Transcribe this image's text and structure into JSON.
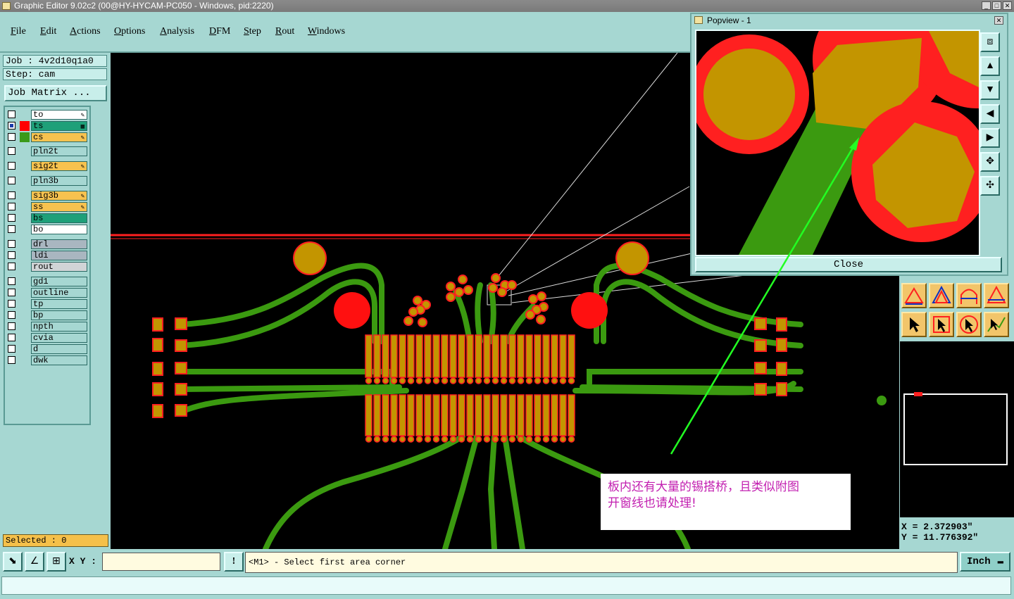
{
  "window": {
    "title": "Graphic Editor 9.02c2 (00@HY-HYCAM-PC050 - Windows, pid:2220)"
  },
  "menu": [
    "File",
    "Edit",
    "Actions",
    "Options",
    "Analysis",
    "DFM",
    "Step",
    "Rout",
    "Windows"
  ],
  "job": {
    "job_line": "Job : 4v2d10q1a0",
    "step_line": "Step: cam",
    "matrix_button": "Job Matrix ..."
  },
  "layers": [
    {
      "name": "to",
      "color": "#ffffff",
      "checked": false,
      "swatch": "",
      "mark": "✎"
    },
    {
      "name": "ts",
      "color": "#1ea079",
      "checked": true,
      "swatch": "#ff0000",
      "mark": "▦"
    },
    {
      "name": "cs",
      "color": "#f7c24f",
      "checked": false,
      "swatch": "#3a9a1a",
      "mark": "✎"
    },
    {
      "name": "pln2t",
      "color": "#a6d7d2",
      "checked": false,
      "swatch": "",
      "mark": ""
    },
    {
      "name": "sig2t",
      "color": "#f7c24f",
      "checked": false,
      "swatch": "",
      "mark": "✎"
    },
    {
      "name": "pln3b",
      "color": "#a6d7d2",
      "checked": false,
      "swatch": "",
      "mark": ""
    },
    {
      "name": "sig3b",
      "color": "#f7c24f",
      "checked": false,
      "swatch": "",
      "mark": "✎"
    },
    {
      "name": "ss",
      "color": "#f7c24f",
      "checked": false,
      "swatch": "",
      "mark": "✎"
    },
    {
      "name": "bs",
      "color": "#1ea079",
      "checked": false,
      "swatch": "",
      "mark": ""
    },
    {
      "name": "bo",
      "color": "#ffffff",
      "checked": false,
      "swatch": "",
      "mark": ""
    },
    {
      "name": "drl",
      "color": "#a9b6c0",
      "checked": false,
      "swatch": "",
      "mark": ""
    },
    {
      "name": "ldi",
      "color": "#a9b6c0",
      "checked": false,
      "swatch": "",
      "mark": ""
    },
    {
      "name": "rout",
      "color": "#d0d4d6",
      "checked": false,
      "swatch": "",
      "mark": ""
    },
    {
      "name": "gd1",
      "color": "#a6d7d2",
      "checked": false,
      "swatch": "",
      "mark": ""
    },
    {
      "name": "outline",
      "color": "#a6d7d2",
      "checked": false,
      "swatch": "",
      "mark": ""
    },
    {
      "name": "tp",
      "color": "#a6d7d2",
      "checked": false,
      "swatch": "",
      "mark": ""
    },
    {
      "name": "bp",
      "color": "#a6d7d2",
      "checked": false,
      "swatch": "",
      "mark": ""
    },
    {
      "name": "npth",
      "color": "#a6d7d2",
      "checked": false,
      "swatch": "",
      "mark": ""
    },
    {
      "name": "cvia",
      "color": "#a6d7d2",
      "checked": false,
      "swatch": "",
      "mark": ""
    },
    {
      "name": "d",
      "color": "#a6d7d2",
      "checked": false,
      "swatch": "",
      "mark": ""
    },
    {
      "name": "dwk",
      "color": "#a6d7d2",
      "checked": false,
      "swatch": "",
      "mark": ""
    }
  ],
  "selected": "Selected : 0",
  "popview": {
    "title": "Popview - 1",
    "close_label": "Close"
  },
  "coords": {
    "x": "X = 2.372903\"",
    "y": "Y = 11.776392\""
  },
  "statusbar": {
    "xy_label": "X Y :",
    "xy_value": "",
    "message": "<M1> - Select first area corner",
    "unit": "Inch"
  },
  "annotation": {
    "line1": "板内还有大量的锡搭桥，且类似附图",
    "line2": "开窗线也请处理!"
  },
  "colors": {
    "copper": "#c39500",
    "mask": "#ff1a1a",
    "trace": "#3b9a10",
    "arrow": "#22ff22"
  }
}
